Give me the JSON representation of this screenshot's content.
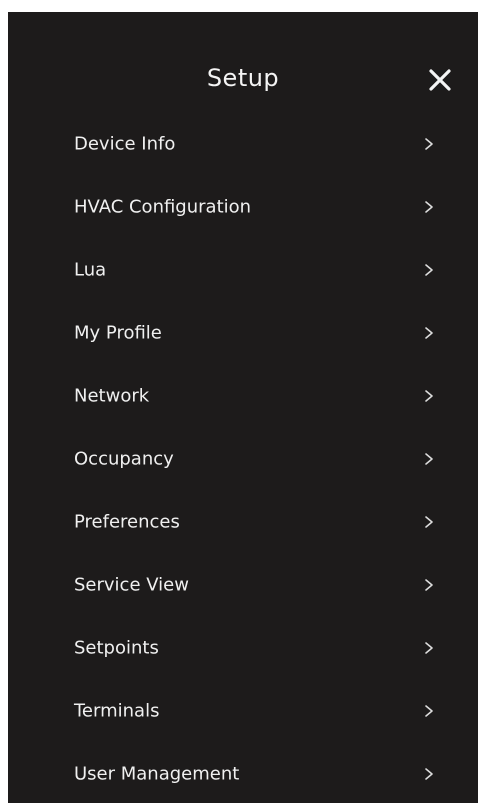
{
  "header": {
    "title": "Setup",
    "close_icon": "close-icon"
  },
  "menu": {
    "items": [
      {
        "label": "Device Info",
        "icon": "chevron-right-icon"
      },
      {
        "label": "HVAC Configuration",
        "icon": "chevron-right-icon"
      },
      {
        "label": "Lua",
        "icon": "chevron-right-icon"
      },
      {
        "label": "My Profile",
        "icon": "chevron-right-icon"
      },
      {
        "label": "Network",
        "icon": "chevron-right-icon"
      },
      {
        "label": "Occupancy",
        "icon": "chevron-right-icon"
      },
      {
        "label": "Preferences",
        "icon": "chevron-right-icon"
      },
      {
        "label": "Service View",
        "icon": "chevron-right-icon"
      },
      {
        "label": "Setpoints",
        "icon": "chevron-right-icon"
      },
      {
        "label": "Terminals",
        "icon": "chevron-right-icon"
      },
      {
        "label": "User Management",
        "icon": "chevron-right-icon"
      }
    ]
  },
  "colors": {
    "panel_background": "#1d1b1b",
    "text": "#f0f0f0",
    "page_background": "#ffffff"
  }
}
